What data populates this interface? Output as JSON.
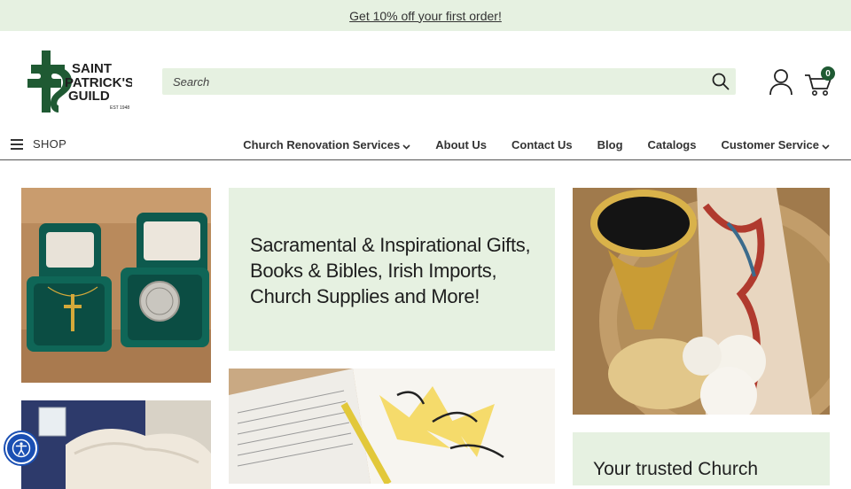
{
  "promo": {
    "text": "Get 10% off your first order!"
  },
  "brand": {
    "name_line1": "SAINT",
    "name_line2": "PATRICK'S",
    "name_line3": "GUILD",
    "est": "EST 1948",
    "color": "#1f5a33"
  },
  "search": {
    "placeholder": "Search",
    "value": ""
  },
  "cart": {
    "count": "0"
  },
  "nav": {
    "shop_label": "SHOP",
    "items": [
      {
        "label": "Church Renovation Services",
        "has_dropdown": true
      },
      {
        "label": "About Us",
        "has_dropdown": false
      },
      {
        "label": "Contact Us",
        "has_dropdown": false
      },
      {
        "label": "Blog",
        "has_dropdown": false
      },
      {
        "label": "Catalogs",
        "has_dropdown": false
      },
      {
        "label": "Customer Service",
        "has_dropdown": true
      }
    ]
  },
  "hero": {
    "text": "Sacramental & Inspirational Gifts, Books & Bibles, Irish Imports, Church Supplies and More!"
  },
  "trusted": {
    "text": "Your trusted Church"
  },
  "colors": {
    "accent_bg": "#e6f1e1",
    "brand_green": "#1f5a33",
    "accessibility_blue": "#1a4fb3"
  },
  "icons": [
    "search-icon",
    "account-icon",
    "cart-icon",
    "hamburger-icon",
    "chevron-down-icon",
    "accessibility-icon"
  ]
}
